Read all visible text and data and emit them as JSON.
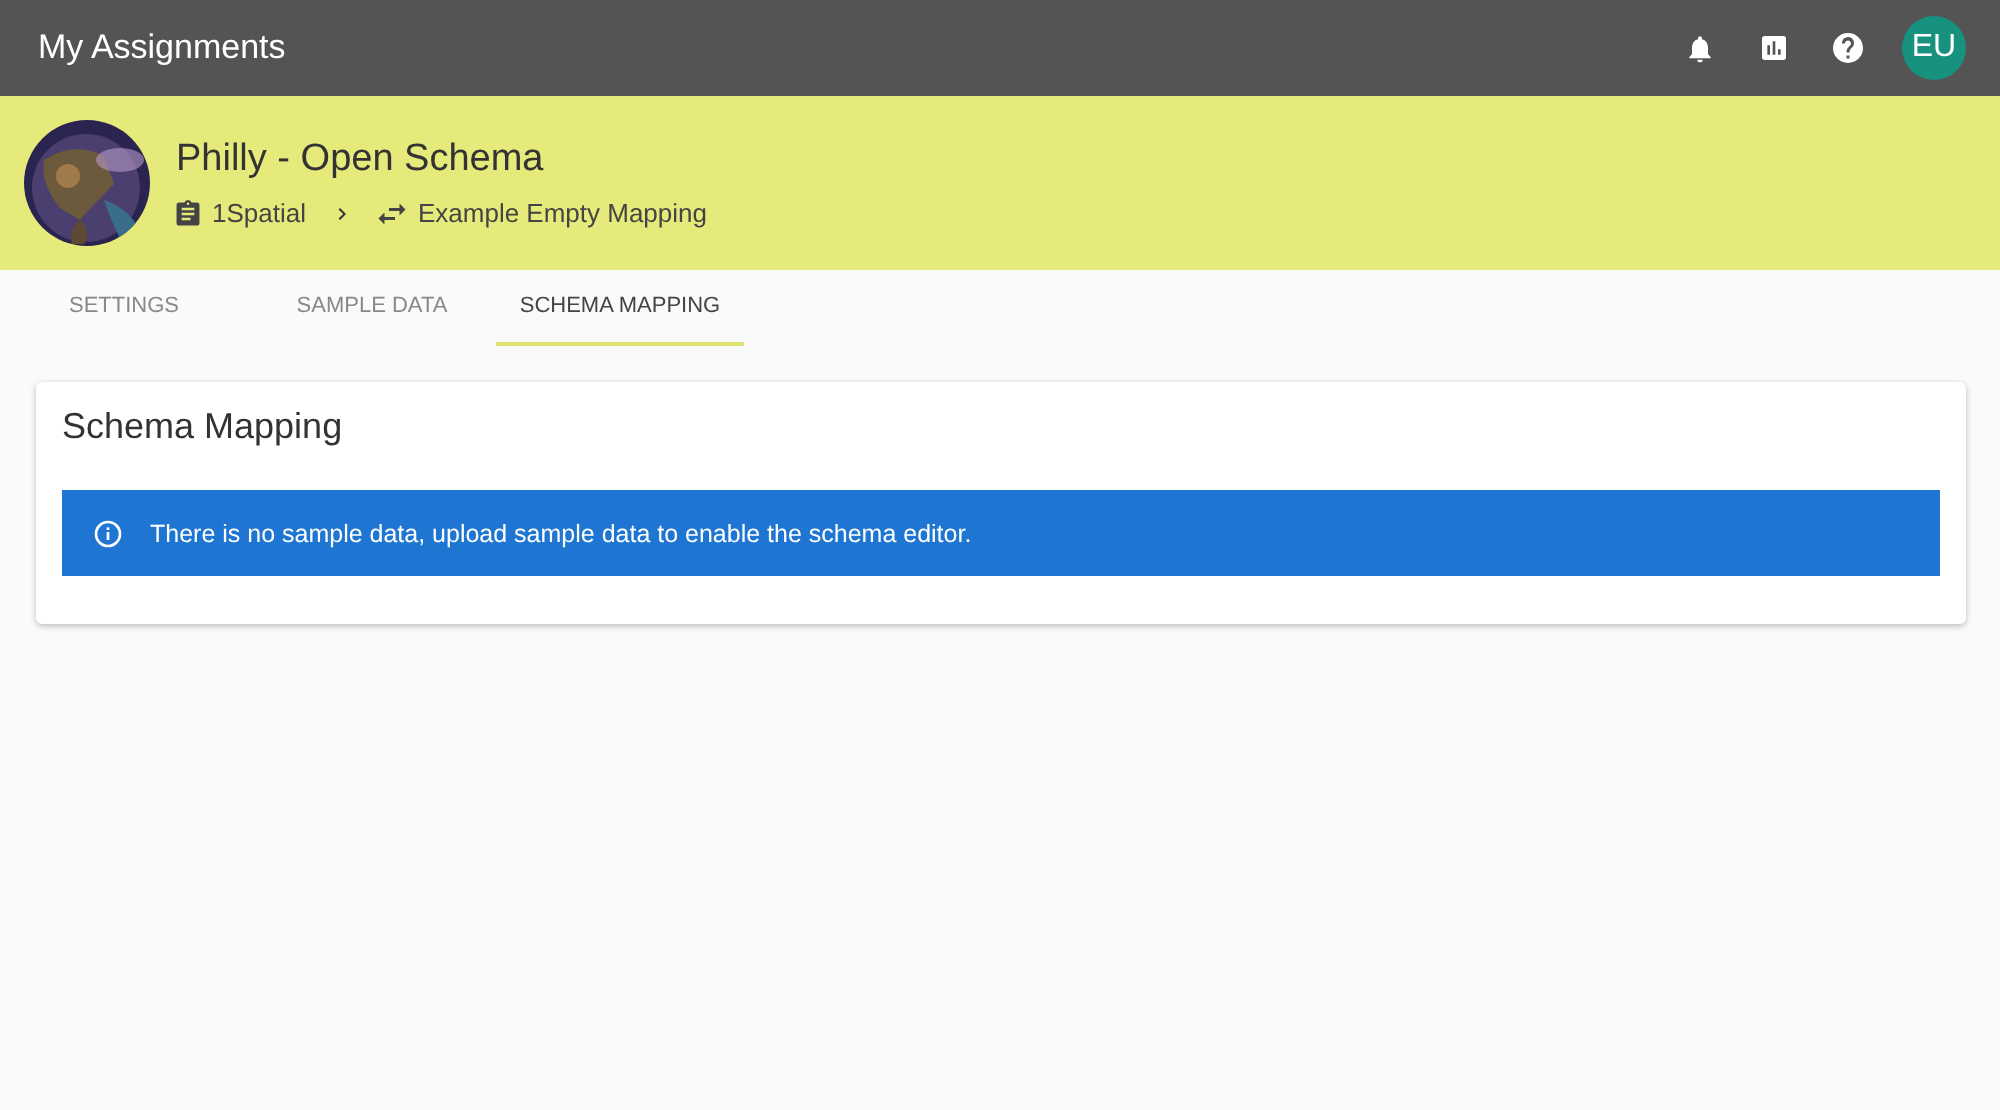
{
  "app_bar": {
    "title": "My Assignments",
    "avatar": "EU"
  },
  "header": {
    "title": "Philly - Open Schema",
    "breadcrumb": [
      {
        "kind": "project",
        "label": "1Spatial"
      },
      {
        "kind": "mapping",
        "label": "Example Empty Mapping"
      }
    ]
  },
  "tabs": [
    {
      "label": "SETTINGS",
      "selected": false
    },
    {
      "label": "SAMPLE DATA",
      "selected": false
    },
    {
      "label": "SCHEMA MAPPING",
      "selected": true
    }
  ],
  "card": {
    "title": "Schema Mapping",
    "alert": "There is no sample data, upload sample data to enable the schema editor."
  }
}
